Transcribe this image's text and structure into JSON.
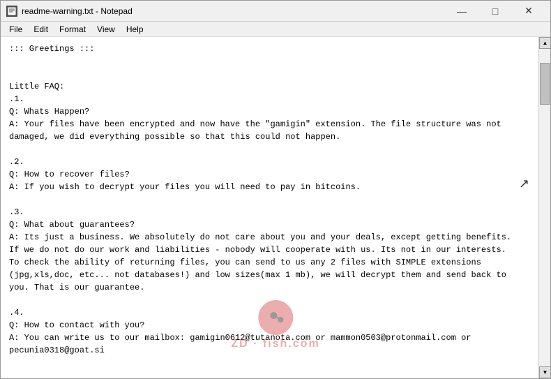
{
  "window": {
    "title": "readme-warning.txt - Notepad",
    "icon": "📄"
  },
  "titlebar": {
    "minimize_label": "—",
    "maximize_label": "□",
    "close_label": "✕"
  },
  "menubar": {
    "items": [
      "File",
      "Edit",
      "Format",
      "View",
      "Help"
    ]
  },
  "content": {
    "text": "::: Greetings :::\n\n\nLittle FAQ:\n.1.\nQ: Whats Happen?\nA: Your files have been encrypted and now have the \"gamigin\" extension. The file structure was not\ndamaged, we did everything possible so that this could not happen.\n\n.2.\nQ: How to recover files?\nA: If you wish to decrypt your files you will need to pay in bitcoins.\n\n.3.\nQ: What about guarantees?\nA: Its just a business. We absolutely do not care about you and your deals, except getting benefits.\nIf we do not do our work and liabilities - nobody will cooperate with us. Its not in our interests.\nTo check the ability of returning files, you can send to us any 2 files with SIMPLE extensions\n(jpg,xls,doc, etc... not databases!) and low sizes(max 1 mb), we will decrypt them and send back to\nyou. That is our guarantee.\n\n.4.\nQ: How to contact with you?\nA: You can write us to our mailbox: gamigin0612@tutanota.com or mammon0503@protonmail.com or\npecunia0318@goat.si\n\n\nQ: Will the decryption process proceed after payment?\nA: After payment we will send to you our scanner-decoder program and detailed instructions for use.\nWith this program you will be able to decrypt all your encrypted files."
  }
}
